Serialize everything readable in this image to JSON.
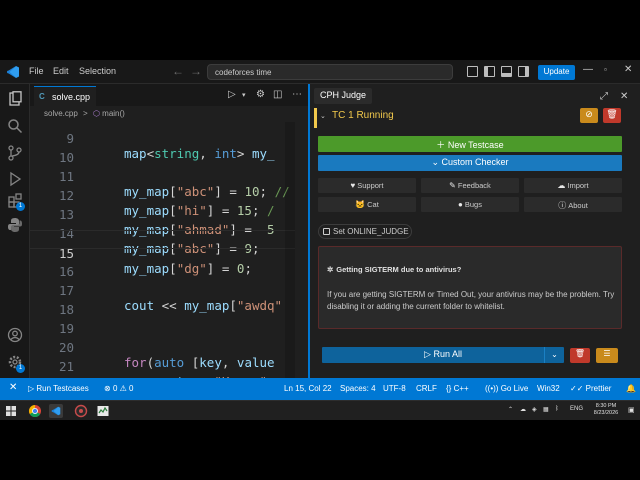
{
  "titlebar": {
    "menu": [
      "File",
      "Edit",
      "Selection"
    ],
    "search_text": "codeforces time",
    "update_label": "Update"
  },
  "editor": {
    "tab_label": "solve.cpp",
    "breadcrumb_file": "solve.cpp",
    "breadcrumb_sep": ">",
    "breadcrumb_symbol": "main()",
    "code_lines": [
      {
        "num": "9",
        "text": "map<string, int> my_"
      },
      {
        "num": "10",
        "text": ""
      },
      {
        "num": "11",
        "text": "my_map[\"abc\"] = 10; //"
      },
      {
        "num": "12",
        "text": "my_map[\"hi\"] = 15; /"
      },
      {
        "num": "13",
        "text": "my_map[\"ahmad\"] = -5"
      },
      {
        "num": "14",
        "text": "my_map[\"abc\"] = 9;"
      },
      {
        "num": "15",
        "text": "my_map[\"dg\"] = 0;"
      },
      {
        "num": "16",
        "text": ""
      },
      {
        "num": "17",
        "text": "cout << my_map[\"awdq\""
      },
      {
        "num": "18",
        "text": ""
      },
      {
        "num": "19",
        "text": ""
      },
      {
        "num": "20",
        "text": "for(auto [key, value"
      },
      {
        "num": "21",
        "text": "    cout << \"Key: \" <<"
      }
    ]
  },
  "cph": {
    "title": "CPH Judge",
    "testcase_label": "TC 1 Running",
    "new_testcase": "New Testcase",
    "custom_checker": "Custom Checker",
    "buttons": [
      "Support",
      "Feedback",
      "Import",
      "Cat",
      "Bugs",
      "About"
    ],
    "online_judge": "Set ONLINE_JUDGE",
    "warning_title": "Getting SIGTERM due to antivirus?",
    "warning_body": "If you are getting SIGTERM or Timed Out, your antivirus may be the problem. Try disabling it or adding the current folder to whitelist.",
    "run_all": "Run All"
  },
  "statusbar": {
    "run_testcases": "Run Testcases",
    "errors": "0",
    "warnings": "0",
    "position": "Ln 15, Col 22",
    "spaces": "Spaces: 4",
    "encoding": "UTF-8",
    "eol": "CRLF",
    "language": "C++",
    "golive": "Go Live",
    "platform": "Win32",
    "prettier": "Prettier"
  },
  "taskbar": {
    "lang": "ENG",
    "time": "8:30 PM",
    "date": "8/23/2026"
  },
  "colors": {
    "accent": "#0078d4",
    "new_testcase": "#4c9a2a",
    "custom_checker": "#1a7abf",
    "running": "#f2c94c"
  }
}
